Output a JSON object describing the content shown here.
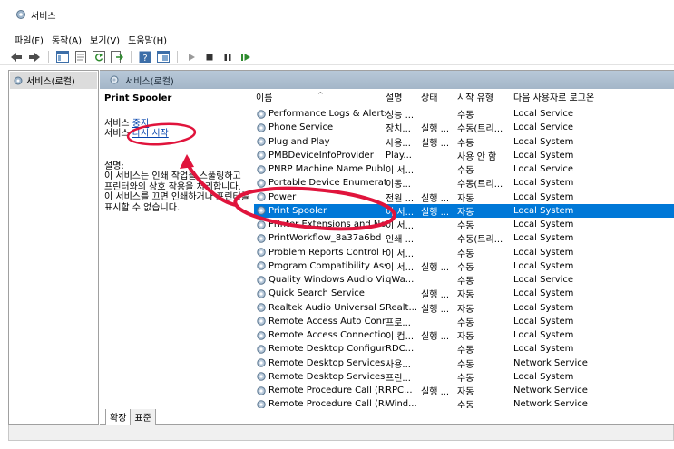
{
  "window": {
    "title": "서비스"
  },
  "menu": [
    "파일(F)",
    "동작(A)",
    "보기(V)",
    "도움말(H)"
  ],
  "toolbar": {
    "icons": [
      "back-icon",
      "forward-icon",
      "console-tree-icon",
      "properties-icon",
      "refresh-icon",
      "export-icon",
      "help-icon",
      "view-icon",
      "start-icon",
      "stop-icon",
      "pause-icon",
      "resume-icon"
    ]
  },
  "tree": {
    "root": "서비스(로컬)"
  },
  "header": {
    "title": "서비스(로컬)"
  },
  "description": {
    "service_name": "Print Spooler",
    "stop_prefix": "서비스 ",
    "stop_link": "중지",
    "restart_prefix": "서비스 ",
    "restart_link": "다시 시작",
    "desc_label": "설명:",
    "desc_text": "이 서비스는 인쇄 작업을 스풀링하고 프린터와의 상호 작용을 처리합니다. 이 서비스를 끄면 인쇄하거나 프린터를 표시할 수 없습니다."
  },
  "columns": [
    "이름",
    "설명",
    "상태",
    "시작 유형",
    "다음 사용자로 로그온"
  ],
  "rows": [
    [
      "Performance Logs & Alerts",
      "성능 ...",
      "",
      "수동",
      "Local Service"
    ],
    [
      "Phone Service",
      "장치...",
      "실행 ...",
      "수동(트리...",
      "Local Service"
    ],
    [
      "Plug and Play",
      "사용...",
      "실행 ...",
      "수동",
      "Local System"
    ],
    [
      "PMBDeviceInfoProvider",
      "Play...",
      "",
      "사용 안 함",
      "Local System"
    ],
    [
      "PNRP Machine Name Publi...",
      "이 서...",
      "",
      "수동",
      "Local Service"
    ],
    [
      "Portable Device Enumerato...",
      "이동...",
      "",
      "수동(트리...",
      "Local System"
    ],
    [
      "Power",
      "전원 ...",
      "실행 ...",
      "자동",
      "Local System"
    ],
    [
      "Print Spooler",
      "이 서...",
      "실행 ...",
      "자동",
      "Local System"
    ],
    [
      "Printer Extensions and Not...",
      "이 서...",
      "",
      "수동",
      "Local System"
    ],
    [
      "PrintWorkflow_8a37a6bd",
      "인쇄 ...",
      "",
      "수동(트리...",
      "Local System"
    ],
    [
      "Problem Reports Control P...",
      "이 서...",
      "",
      "수동",
      "Local System"
    ],
    [
      "Program Compatibility Assi...",
      "이 서...",
      "실행 ...",
      "수동",
      "Local System"
    ],
    [
      "Quality Windows Audio Vi...",
      "qWa...",
      "",
      "수동",
      "Local Service"
    ],
    [
      "Quick Search Service",
      "",
      "실행 ...",
      "자동",
      "Local System"
    ],
    [
      "Realtek Audio Universal Ser...",
      "Realt...",
      "실행 ...",
      "자동",
      "Local System"
    ],
    [
      "Remote Access Auto Conn...",
      "프로...",
      "",
      "수동",
      "Local System"
    ],
    [
      "Remote Access Connection...",
      "이 컴...",
      "실행 ...",
      "자동",
      "Local System"
    ],
    [
      "Remote Desktop Configura...",
      "RDC...",
      "",
      "수동",
      "Local System"
    ],
    [
      "Remote Desktop Services",
      "사용...",
      "",
      "수동",
      "Network Service"
    ],
    [
      "Remote Desktop Services ...",
      "프린...",
      "",
      "수동",
      "Local System"
    ],
    [
      "Remote Procedure Call (RP...",
      "RPC...",
      "실행 ...",
      "자동",
      "Network Service"
    ],
    [
      "Remote Procedure Call (RP...",
      "Wind...",
      "",
      "수동",
      "Network Service"
    ]
  ],
  "selected_row": "Print Spooler",
  "tabs": [
    "확장",
    "표준"
  ],
  "colors": {
    "selection": "#0078d7",
    "annotation": "#e0143c",
    "link": "#0645ad"
  }
}
